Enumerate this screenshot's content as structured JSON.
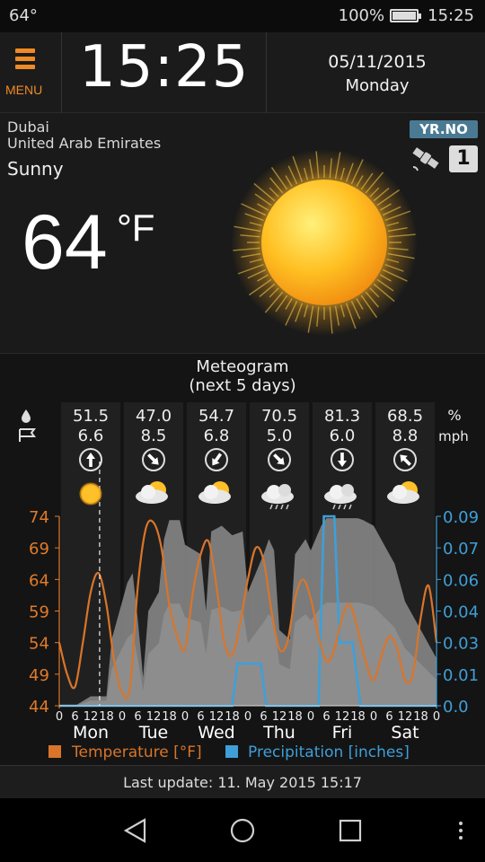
{
  "status": {
    "temperature": "64°",
    "battery": "100%",
    "battery_level": 1.0,
    "time": "15:25"
  },
  "header": {
    "menu_label": "MENU",
    "clock": "15:25",
    "date": "05/11/2015",
    "weekday": "Monday"
  },
  "current": {
    "city": "Dubai",
    "country": "United Arab Emirates",
    "condition": "Sunny",
    "temperature": "64",
    "unit": "°F",
    "provider": "YR.NO",
    "source_badge": "1",
    "icon": "sun-icon"
  },
  "meteogram": {
    "title_line1": "Meteogram",
    "title_line2": "(next 5 days)",
    "humidity_unit": "%",
    "wind_unit": "mph",
    "days": [
      {
        "label": "Mon",
        "humidity": "51.5",
        "wind": "6.6",
        "wind_dir_deg": 0,
        "icon": "sun-icon"
      },
      {
        "label": "Tue",
        "humidity": "47.0",
        "wind": "8.5",
        "wind_dir_deg": 135,
        "icon": "partly-cloudy-icon"
      },
      {
        "label": "Wed",
        "humidity": "54.7",
        "wind": "6.8",
        "wind_dir_deg": 215,
        "icon": "partly-cloudy-icon"
      },
      {
        "label": "Thu",
        "humidity": "70.5",
        "wind": "5.0",
        "wind_dir_deg": 135,
        "icon": "cloud-rain-icon"
      },
      {
        "label": "Fri",
        "humidity": "81.3",
        "wind": "6.0",
        "wind_dir_deg": 180,
        "icon": "cloud-rain-icon"
      },
      {
        "label": "Sat",
        "humidity": "68.5",
        "wind": "8.8",
        "wind_dir_deg": 315,
        "icon": "partly-cloudy-icon"
      }
    ],
    "legend_temperature": "Temperature [°F]",
    "legend_precipitation": "Precipitation [inches]"
  },
  "chart_data": {
    "type": "line",
    "xlabel": "",
    "hour_ticks": [
      "0",
      "6",
      "12",
      "18"
    ],
    "x_hours_range": [
      0,
      144
    ],
    "now_hour": 15.4,
    "left_axis": {
      "label": "Temperature [°F]",
      "ticks": [
        "74",
        "69",
        "64",
        "59",
        "54",
        "49",
        "44"
      ],
      "range": [
        44,
        74
      ],
      "color": "#e07a2a"
    },
    "right_axis": {
      "label": "Precipitation [inches]",
      "ticks": [
        "0.09",
        "0.07",
        "0.06",
        "0.04",
        "0.03",
        "0.01",
        "0.0"
      ],
      "range": [
        0,
        0.09
      ],
      "color": "#3f9fd8"
    },
    "series": [
      {
        "name": "Temperature [°F]",
        "color": "#d9752a",
        "x": [
          0,
          3,
          6,
          9,
          12,
          15,
          18,
          21,
          24,
          27,
          30,
          33,
          36,
          39,
          42,
          45,
          48,
          51,
          54,
          57,
          60,
          63,
          66,
          69,
          72,
          75,
          78,
          81,
          84,
          87,
          90,
          93,
          96,
          99,
          102,
          105,
          108,
          111,
          114,
          117,
          120,
          123,
          126,
          129,
          132,
          135,
          138,
          141,
          144
        ],
        "y": [
          54,
          49,
          47,
          54,
          62,
          65,
          60,
          51,
          46,
          47,
          63,
          72,
          73,
          69,
          60,
          55,
          53,
          62,
          68,
          70,
          63,
          54,
          52,
          57,
          64,
          69,
          67,
          59,
          53,
          54,
          61,
          64,
          61,
          55,
          51,
          53,
          58,
          60,
          56,
          51,
          48,
          52,
          55,
          53,
          48,
          49,
          58,
          63,
          54
        ]
      },
      {
        "name": "Precipitation [inches]",
        "color": "#3f9fd8",
        "x": [
          0,
          66,
          68,
          77,
          79,
          99,
          101,
          105,
          107,
          108,
          111,
          112,
          115,
          144
        ],
        "y": [
          0,
          0,
          0.02,
          0.02,
          0,
          0,
          0.09,
          0.09,
          0.03,
          0.03,
          0.03,
          0.03,
          0,
          0
        ]
      },
      {
        "name": "Cloud cover",
        "color": "#8a8a8a",
        "x": [
          0,
          6,
          12,
          18,
          20,
          24,
          26,
          28,
          30,
          32,
          34,
          38,
          40,
          42,
          46,
          48,
          54,
          56,
          58,
          62,
          66,
          70,
          72,
          78,
          80,
          82,
          84,
          88,
          90,
          94,
          96,
          100,
          102,
          106,
          108,
          110,
          114,
          116,
          120,
          124,
          126,
          128,
          130,
          132,
          136,
          140,
          144
        ],
        "y": [
          0,
          0,
          0.05,
          0.05,
          0.35,
          0.55,
          0.65,
          0.7,
          0.45,
          0.15,
          0.5,
          0.6,
          0.88,
          0.98,
          0.98,
          0.85,
          0.8,
          0.5,
          0.92,
          0.95,
          0.9,
          0.92,
          0.6,
          0.8,
          0.88,
          0.82,
          0.4,
          0.35,
          0.8,
          0.88,
          0.82,
          0.95,
          0.99,
          0.99,
          0.99,
          0.99,
          0.99,
          0.98,
          0.95,
          0.85,
          0.8,
          0.75,
          0.65,
          0.55,
          0.45,
          0.35,
          0.25
        ]
      }
    ],
    "grid": false,
    "legend_position": "bottom"
  },
  "footer": {
    "last_update": "Last update: 11. May 2015  15:17"
  },
  "navbar": {
    "back": "back-icon",
    "home": "home-icon",
    "recents": "recents-icon",
    "more": "more-icon"
  }
}
